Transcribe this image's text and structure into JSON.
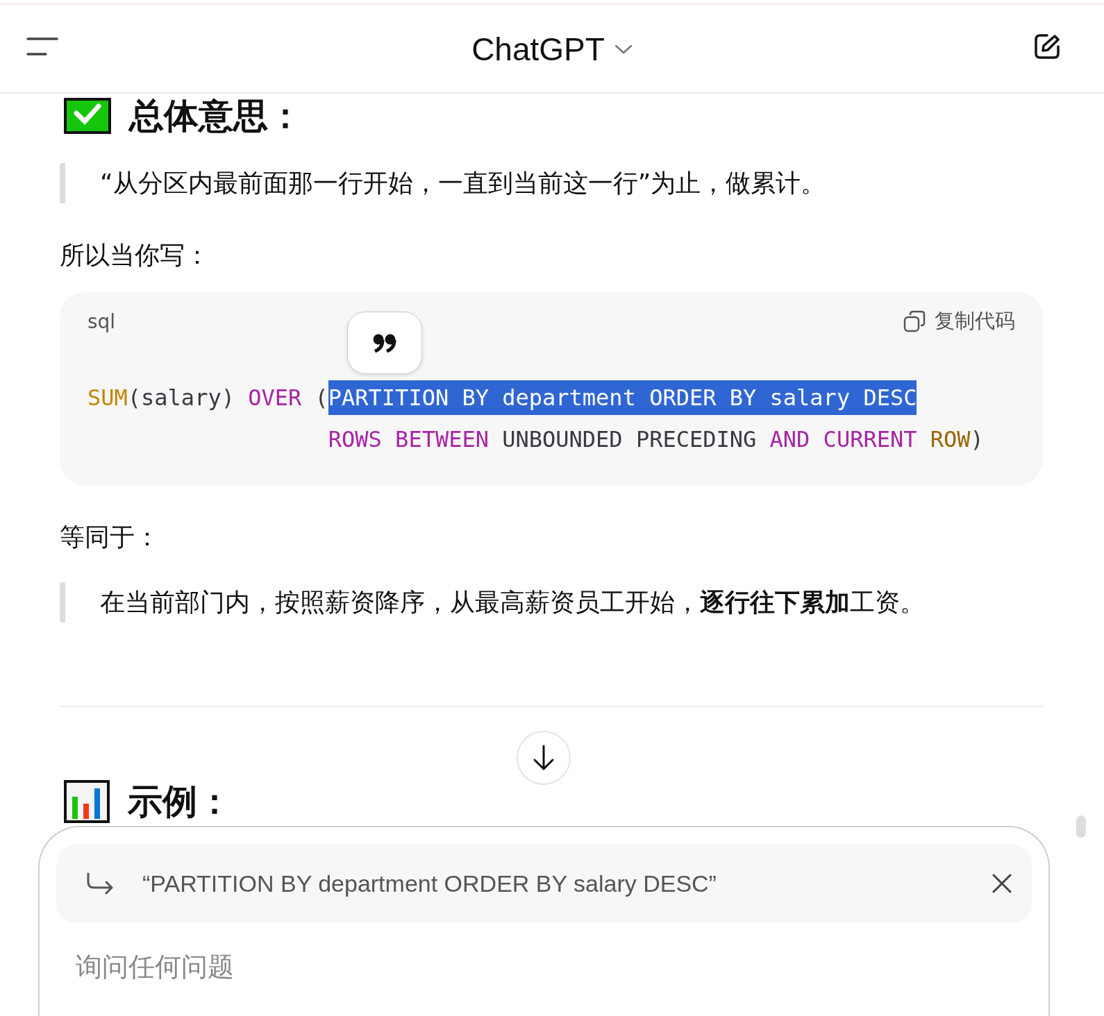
{
  "header": {
    "title": "ChatGPT"
  },
  "content": [
    {
      "kind": "heading",
      "text": "总体意思："
    },
    {
      "kind": "quote",
      "text": "“从分区内最前面那一行开始，一直到当前这一行”为止，做累计。"
    },
    {
      "kind": "para",
      "text": "所以当你写："
    },
    {
      "kind": "code",
      "language": "sql",
      "copy_label": "复制代码",
      "lines": [
        {
          "continuation": false,
          "tokens": [
            {
              "text": "SUM",
              "kind": "func",
              "selected": false
            },
            {
              "text": "(salary) ",
              "kind": "plain",
              "selected": false
            },
            {
              "text": "OVER",
              "kind": "keyword",
              "selected": false
            },
            {
              "text": " (",
              "kind": "plain",
              "selected": false
            },
            {
              "text": "PARTITION BY department ORDER BY salary DESC",
              "kind": "plain",
              "selected": true
            }
          ]
        },
        {
          "continuation": true,
          "tokens": [
            {
              "text": "ROWS BETWEEN",
              "kind": "keyword",
              "selected": false
            },
            {
              "text": " UNBOUNDED PRECEDING ",
              "kind": "plain",
              "selected": false
            },
            {
              "text": "AND CURRENT ",
              "kind": "keyword",
              "selected": false
            },
            {
              "text": "ROW",
              "kind": "builtin",
              "selected": false
            },
            {
              "text": ")",
              "kind": "plain",
              "selected": false
            }
          ]
        }
      ]
    },
    {
      "kind": "para",
      "text": "等同于："
    },
    {
      "kind": "quote",
      "text": "在当前部门内，按照薪资降序，从最高薪资员工开始，**逐行往下累加**工资。"
    },
    {
      "kind": "divider"
    },
    {
      "kind": "heading",
      "text": "示例："
    }
  ],
  "composer": {
    "reply_quote": "“PARTITION BY department ORDER BY salary DESC”",
    "placeholder": "询问任何问题"
  }
}
